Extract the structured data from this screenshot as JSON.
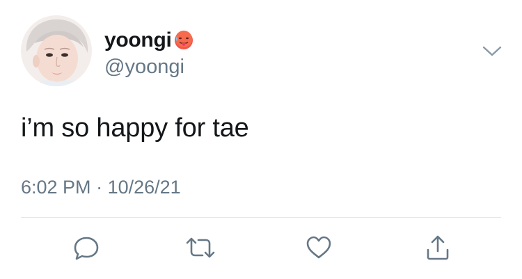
{
  "author": {
    "display_name": "yoongi",
    "handle": "@yoongi",
    "avatar_icon": "user-avatar-photo",
    "name_emoji_icon": "hot-face-emoji"
  },
  "tweet": {
    "text": "i’m so happy for tae",
    "time": "6:02 PM",
    "separator": " · ",
    "date": "10/26/21"
  },
  "actions": [
    {
      "name": "reply",
      "icon": "reply-bubble-icon"
    },
    {
      "name": "retweet",
      "icon": "retweet-icon"
    },
    {
      "name": "like",
      "icon": "heart-icon"
    },
    {
      "name": "share",
      "icon": "share-icon"
    }
  ],
  "colors": {
    "text_primary": "#14171a",
    "text_secondary": "#657786",
    "divider": "#e1e8ed",
    "icon": "#657786"
  }
}
